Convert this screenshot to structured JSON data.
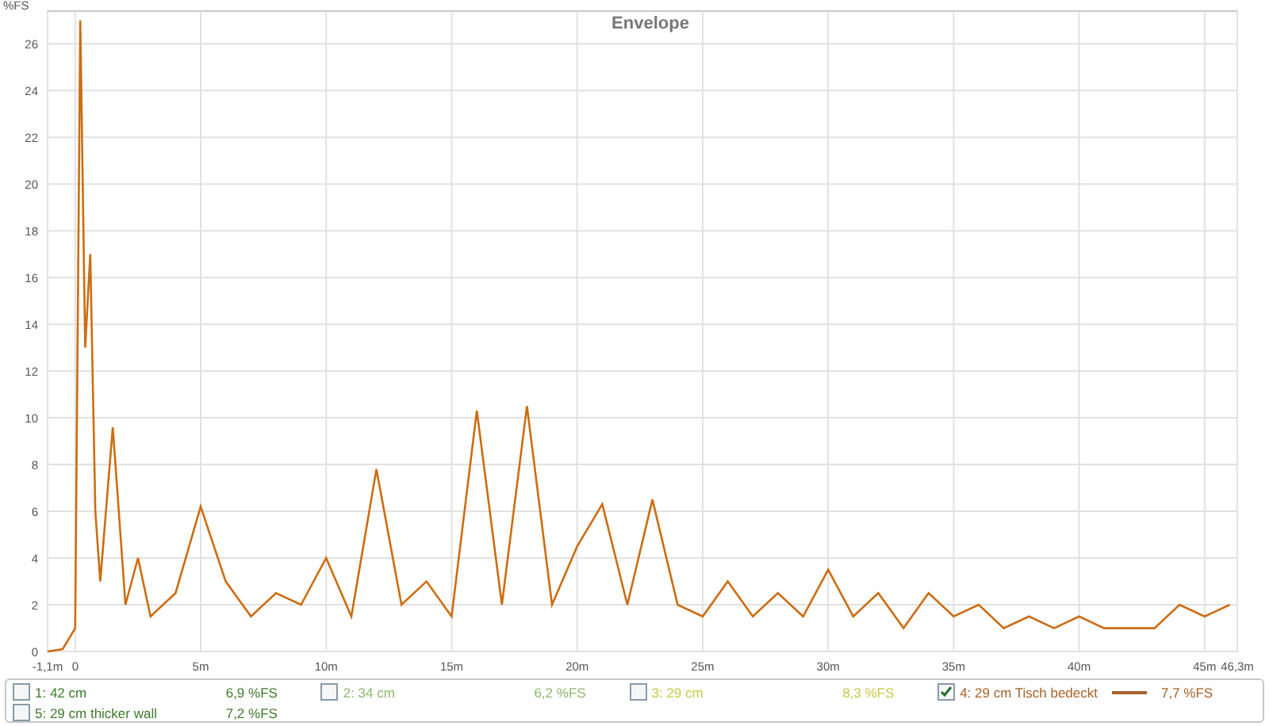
{
  "chart": {
    "chart_data": {
      "type": "line",
      "title": "Envelope",
      "grid": true,
      "ylabel": "%FS",
      "xlim": [
        -1.1,
        46.3
      ],
      "ylim": [
        0,
        27.4
      ],
      "xticks": [
        {
          "value": -1.1,
          "label": "-1,1m"
        },
        {
          "value": 0,
          "label": "0"
        },
        {
          "value": 5,
          "label": "5m"
        },
        {
          "value": 10,
          "label": "10m"
        },
        {
          "value": 15,
          "label": "15m"
        },
        {
          "value": 20,
          "label": "20m"
        },
        {
          "value": 25,
          "label": "25m"
        },
        {
          "value": 30,
          "label": "30m"
        },
        {
          "value": 35,
          "label": "35m"
        },
        {
          "value": 40,
          "label": "40m"
        },
        {
          "value": 45,
          "label": "45m"
        },
        {
          "value": 46.3,
          "label": "46,3m"
        }
      ],
      "yticks": [
        0,
        2,
        4,
        6,
        8,
        10,
        12,
        14,
        16,
        18,
        20,
        22,
        24,
        26
      ],
      "x": [
        -1.1,
        -0.5,
        0,
        0.2,
        0.4,
        0.6,
        0.8,
        1,
        1.5,
        2,
        2.5,
        3,
        4,
        5,
        6,
        7,
        8,
        9,
        10,
        11,
        12,
        13,
        14,
        15,
        16,
        17,
        18,
        19,
        20,
        21,
        22,
        23,
        24,
        25,
        26,
        27,
        28,
        29,
        30,
        31,
        32,
        33,
        34,
        35,
        36,
        37,
        38,
        39,
        40,
        41,
        42,
        43,
        44,
        45,
        46
      ],
      "series": [
        {
          "color": "#cc6d12",
          "values": [
            0,
            0.1,
            1,
            27,
            13,
            17,
            6,
            3,
            9.6,
            2,
            4,
            1.5,
            2.5,
            6.2,
            3,
            1.5,
            2.5,
            2,
            4,
            1.5,
            7.8,
            2,
            3,
            1.5,
            10.3,
            2,
            10.5,
            2,
            4.5,
            6.3,
            2,
            6.5,
            2,
            1.5,
            3,
            1.5,
            2.5,
            1.5,
            3.5,
            1.5,
            2.5,
            1,
            2.5,
            1.5,
            2,
            1,
            1.5,
            1,
            1.5,
            1,
            1,
            1,
            2,
            1.5,
            2
          ]
        }
      ]
    }
  },
  "legend": [
    {
      "label": "1: 42 cm",
      "value": "6,9 %FS",
      "color": "#3f7a2c",
      "checked": false
    },
    {
      "label": "2: 34 cm",
      "value": "6,2 %FS",
      "color": "#8cb86e",
      "checked": false
    },
    {
      "label": "3: 29 cm",
      "value": "8,3 %FS",
      "color": "#c4cc48",
      "checked": false
    },
    {
      "label": "4: 29 cm Tisch bedeckt",
      "value": "7,7 %FS",
      "color": "#a8622a",
      "checked": true
    },
    {
      "label": "5: 29 cm thicker wall",
      "value": "7,2 %FS",
      "color": "#3f7a2c",
      "checked": false
    }
  ]
}
